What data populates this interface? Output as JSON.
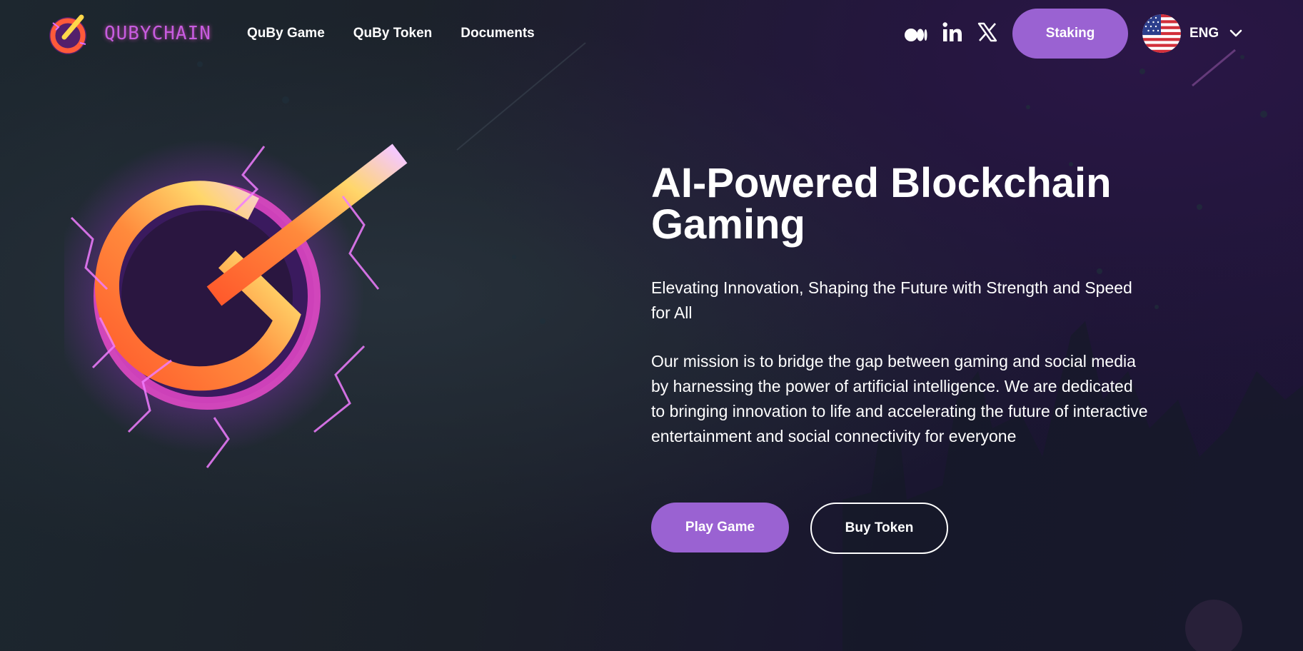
{
  "brand": {
    "name": "QUBYCHAIN"
  },
  "nav": {
    "items": [
      {
        "label": "QuBy Game"
      },
      {
        "label": "QuBy Token"
      },
      {
        "label": "Documents"
      }
    ]
  },
  "social": {
    "icons": [
      "medium-icon",
      "linkedin-icon",
      "x-icon"
    ]
  },
  "header": {
    "staking_label": "Staking",
    "language": "ENG"
  },
  "hero": {
    "title": "AI-Powered Blockchain Gaming",
    "subtitle": "Elevating Innovation, Shaping the Future with Strength and Speed for All",
    "mission": "Our mission is to bridge the gap between gaming and social media by harnessing the power of artificial intelligence. We are dedicated to bringing innovation to life and accelerating the future of interactive entertainment and social connectivity for everyone",
    "play_label": "Play Game",
    "buy_label": "Buy Token"
  },
  "colors": {
    "accent": "#9a62d2",
    "background": "#1b2029",
    "brand_text": "#c75ce0"
  }
}
